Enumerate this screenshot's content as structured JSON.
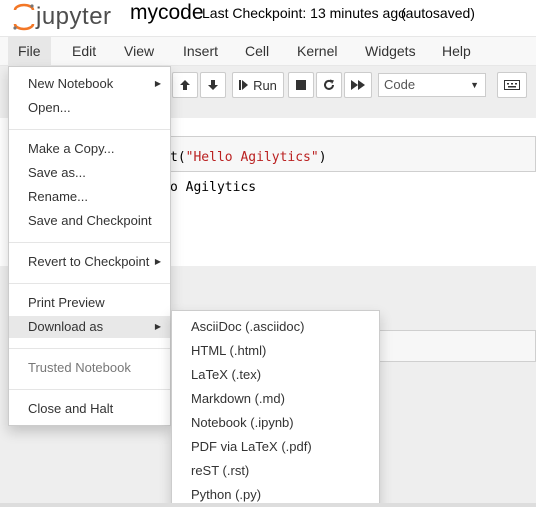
{
  "header": {
    "logo_text": "jupyter",
    "notebook_name": "mycode",
    "checkpoint_status": "Last Checkpoint: 13 minutes ago",
    "autosave_status": "(autosaved)"
  },
  "menubar": {
    "items": [
      "File",
      "Edit",
      "View",
      "Insert",
      "Cell",
      "Kernel",
      "Widgets",
      "Help"
    ]
  },
  "toolbar": {
    "run_label": "Run",
    "cell_type": "Code"
  },
  "cells": {
    "code_prefix": "t(",
    "code_string": "\"Hello Agilytics\"",
    "code_suffix": ")",
    "output_text": "o Agilytics"
  },
  "file_menu": {
    "new_notebook": "New Notebook",
    "open": "Open...",
    "make_copy": "Make a Copy...",
    "save_as": "Save as...",
    "rename": "Rename...",
    "save_checkpoint": "Save and Checkpoint",
    "revert": "Revert to Checkpoint",
    "print_preview": "Print Preview",
    "download_as": "Download as",
    "trusted": "Trusted Notebook",
    "close_halt": "Close and Halt"
  },
  "download_menu": {
    "items": [
      "AsciiDoc (.asciidoc)",
      "HTML (.html)",
      "LaTeX (.tex)",
      "Markdown (.md)",
      "Notebook (.ipynb)",
      "PDF via LaTeX (.pdf)",
      "reST (.rst)",
      "Python (.py)"
    ]
  },
  "colors": {
    "brand_orange": "#F37726",
    "string_red": "#ba2121",
    "menu_highlight": "#e8e8e8"
  }
}
